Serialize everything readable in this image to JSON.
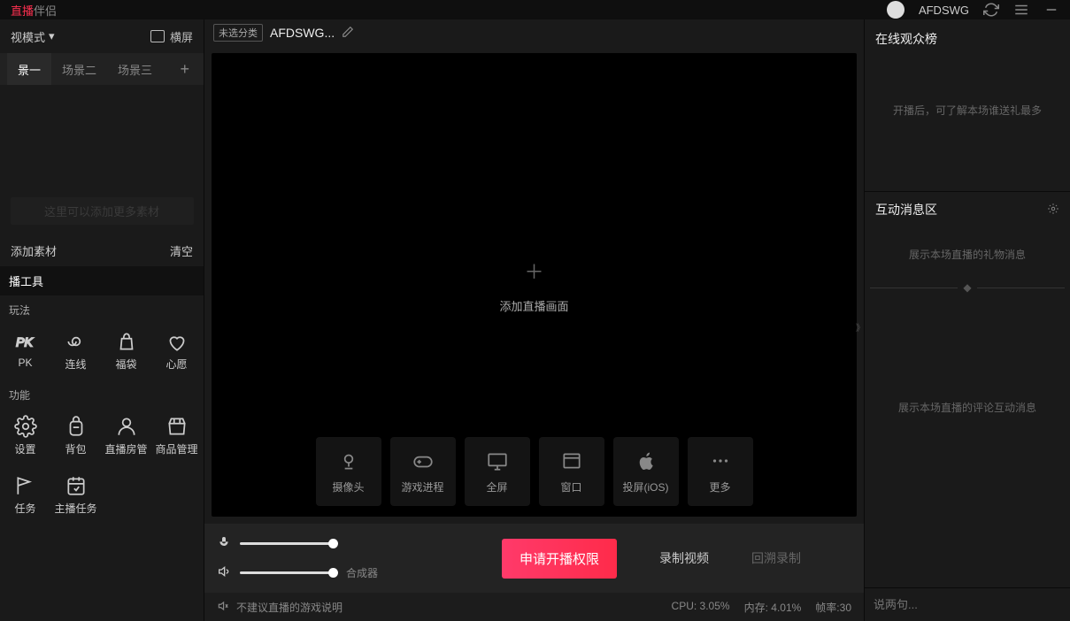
{
  "topbar": {
    "app_suffix": "伴侣",
    "username": "AFDSWG"
  },
  "left": {
    "mode_label": "视模式",
    "orientation_label": "横屏",
    "scene_tabs": [
      "景一",
      "场景二",
      "场景三"
    ],
    "source_hint": "这里可以添加更多素材",
    "add_source": "添加素材",
    "clear": "清空",
    "tools_heading": "播工具",
    "sub1": "玩法",
    "row1": [
      {
        "id": "pk",
        "label": "PK"
      },
      {
        "id": "link",
        "label": "连线"
      },
      {
        "id": "bag",
        "label": "福袋"
      },
      {
        "id": "wish",
        "label": "心愿"
      }
    ],
    "sub2": "功能",
    "row2": [
      {
        "id": "settings",
        "label": "设置"
      },
      {
        "id": "backpack",
        "label": "背包"
      },
      {
        "id": "room-admin",
        "label": "直播房管"
      },
      {
        "id": "goods",
        "label": "商品管理"
      }
    ],
    "row3": [
      {
        "id": "task",
        "label": "任务"
      },
      {
        "id": "anchor-task",
        "label": "主播任务"
      }
    ]
  },
  "center": {
    "tag": "未选分类",
    "title": "AFDSWG...",
    "add_label": "添加直播画面",
    "sources": [
      {
        "id": "camera",
        "label": "摄像头"
      },
      {
        "id": "game",
        "label": "游戏进程"
      },
      {
        "id": "monitor",
        "label": "全屏"
      },
      {
        "id": "window",
        "label": "窗口"
      },
      {
        "id": "ios",
        "label": "投屏(iOS)"
      },
      {
        "id": "more",
        "label": "更多"
      }
    ]
  },
  "bottom": {
    "synth": "合成器",
    "primary": "申请开播权限",
    "record": "录制视频",
    "replay": "回溯录制",
    "game_hint": "不建议直播的游戏说明",
    "cpu_label": "CPU:",
    "cpu_val": "3.05%",
    "mem_label": "内存:",
    "mem_val": "4.01%",
    "fps_label": "帧率:",
    "fps_val": "30"
  },
  "right": {
    "viewers_title": "在线观众榜",
    "viewers_hint": "开播后，可了解本场谁送礼最多",
    "msg_title": "互动消息区",
    "gift_hint": "展示本场直播的礼物消息",
    "chat_hint": "展示本场直播的评论互动消息",
    "input_placeholder": "说两句..."
  }
}
